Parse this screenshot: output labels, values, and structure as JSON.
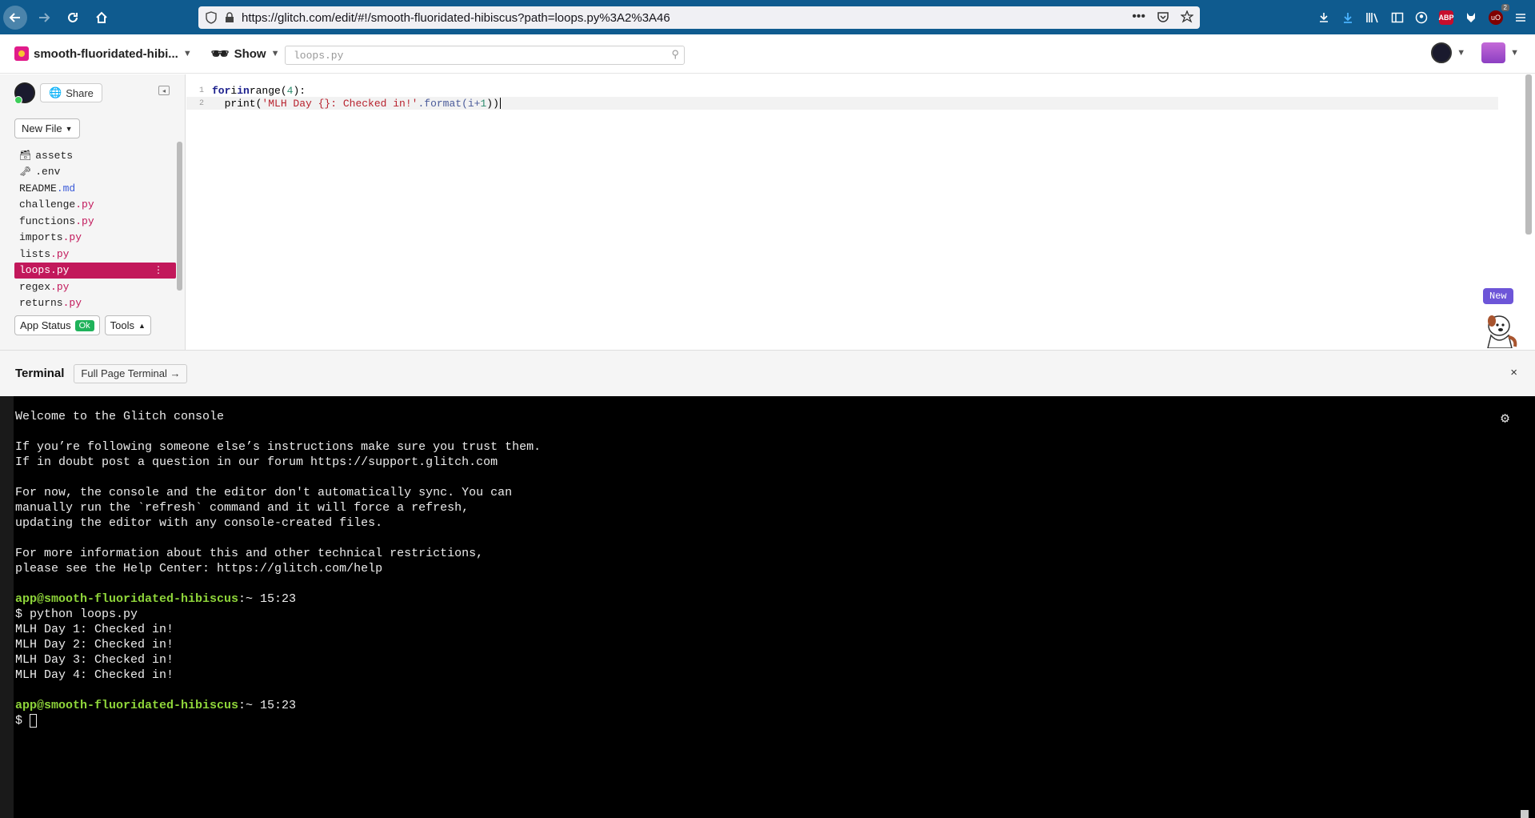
{
  "browser": {
    "url": "https://glitch.com/edit/#!/smooth-fluoridated-hibiscus?path=loops.py%3A2%3A46",
    "ubo_count": "2",
    "abp_label": "ABP",
    "ubo_label": "uO"
  },
  "header": {
    "project_name": "smooth-fluoridated-hibi...",
    "show_label": "Show",
    "search_value": "loops.py"
  },
  "sidebar": {
    "share_label": "Share",
    "new_file_label": "New File",
    "files": [
      {
        "name": "assets",
        "ext": ""
      },
      {
        "name": ".env",
        "ext": ""
      },
      {
        "name": "README",
        "ext": ".md"
      },
      {
        "name": "challenge",
        "ext": ".py"
      },
      {
        "name": "functions",
        "ext": ".py"
      },
      {
        "name": "imports",
        "ext": ".py"
      },
      {
        "name": "lists",
        "ext": ".py"
      },
      {
        "name": "loops",
        "ext": ".py"
      },
      {
        "name": "regex",
        "ext": ".py"
      },
      {
        "name": "returns",
        "ext": ".py"
      }
    ],
    "app_status_label": "App Status",
    "app_status_value": "Ok",
    "tools_label": "Tools"
  },
  "editor": {
    "line_numbers": [
      "1",
      "2"
    ],
    "line1": {
      "kw_for": "for",
      "var": " i ",
      "kw_in": "in",
      "fn": " range(",
      "num": "4",
      "end": "):"
    },
    "line2": {
      "indent": "  print(",
      "str": "'MLH Day {}: Checked in!'",
      "dot": ".format(i+",
      "num": "1",
      "end": "))"
    },
    "new_badge": "New"
  },
  "terminal": {
    "title": "Terminal",
    "full_page_label": "Full Page Terminal →",
    "close_label": "×",
    "lines_intro": [
      "Welcome to the Glitch console",
      "",
      "If you’re following someone else’s instructions make sure you trust them.",
      "If in doubt post a question in our forum https://support.glitch.com",
      "",
      "For now, the console and the editor don't automatically sync. You can",
      "manually run the `refresh` command and it will force a refresh,",
      "updating the editor with any console-created files.",
      "",
      "For more information about this and other technical restrictions,",
      "please see the Help Center: https://glitch.com/help",
      ""
    ],
    "prompt_user": "app@smooth-fluoridated-hibiscus",
    "prompt_suffix": ":~ 15:23",
    "command": "$ python loops.py",
    "output": [
      "MLH Day 1: Checked in!",
      "MLH Day 2: Checked in!",
      "MLH Day 3: Checked in!",
      "MLH Day 4: Checked in!"
    ],
    "prompt_symbol": "$ "
  }
}
